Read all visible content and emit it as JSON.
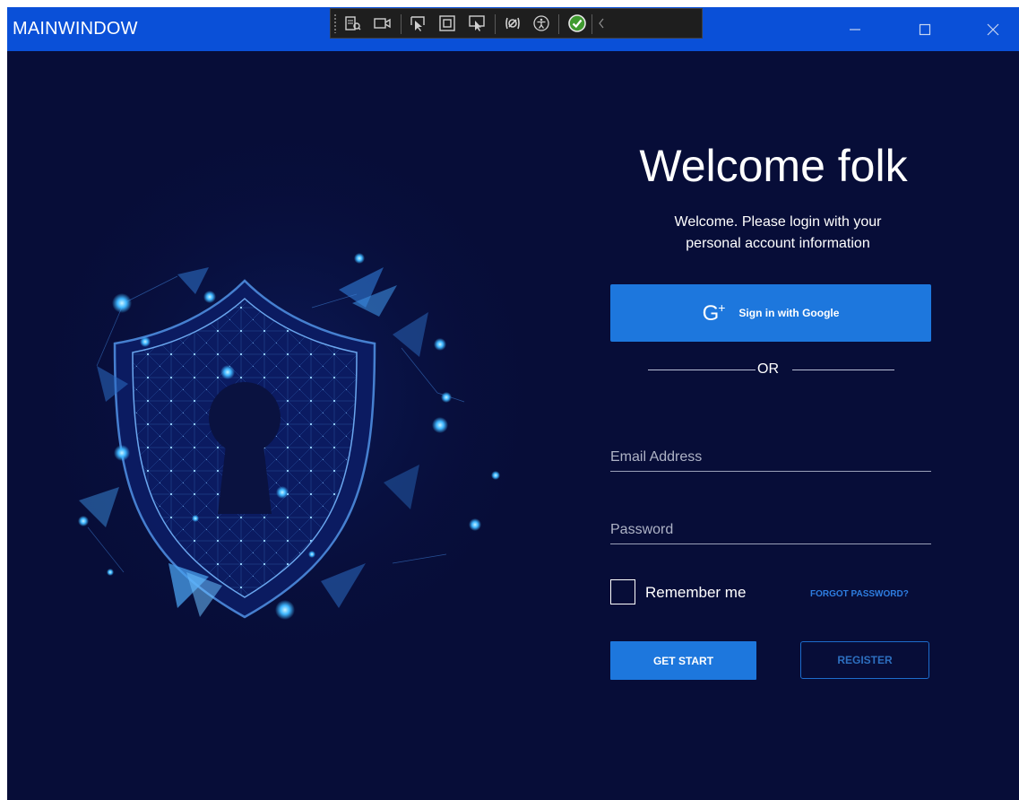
{
  "window": {
    "title": "MAINWINDOW"
  },
  "debug_toolbar": {
    "icons": [
      "live-visual-tree-icon",
      "camera-icon",
      "select-element-icon",
      "display-layout-adorners-icon",
      "track-focus-icon",
      "binding-failures-icon",
      "accessibility-icon",
      "check-icon",
      "collapse-chevron-icon"
    ]
  },
  "login": {
    "heading": "Welcome folk",
    "subtitle_line1": "Welcome. Please login with your",
    "subtitle_line2": "personal account information",
    "google_glyph": "G",
    "google_plus": "+",
    "google_label": "Sign in with Google",
    "or_label": "OR",
    "email_placeholder": "Email Address",
    "password_placeholder": "Password",
    "remember_label": "Remember me",
    "forgot_label": "FORGOT PASSWORD?",
    "start_label": "GET START",
    "register_label": "REGISTER"
  },
  "colors": {
    "titlebar": "#0a50d8",
    "background": "#070d38",
    "accent": "#1d77dd"
  }
}
